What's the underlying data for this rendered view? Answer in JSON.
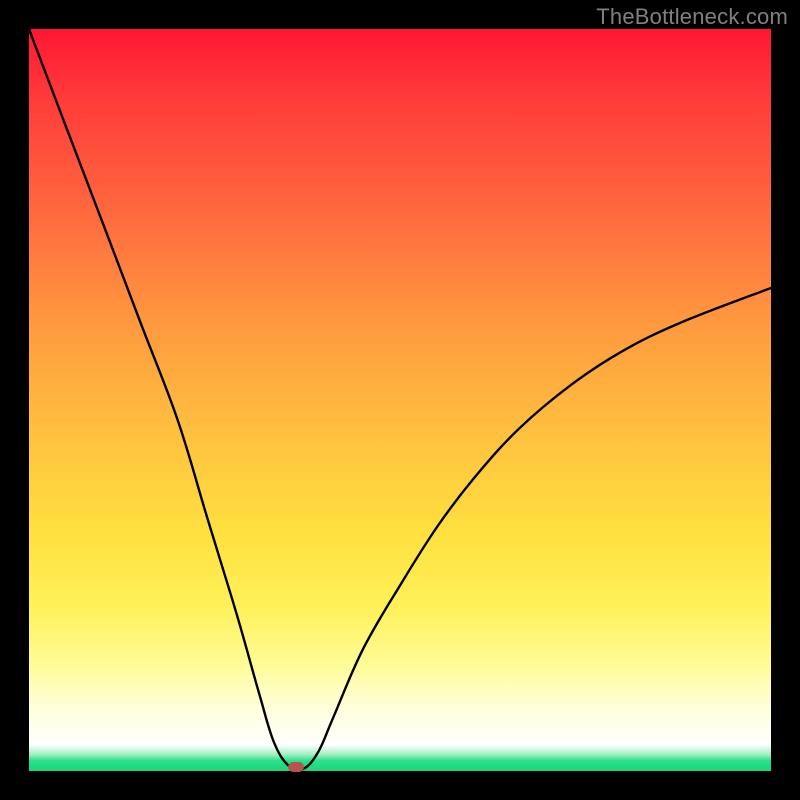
{
  "watermark": "TheBottleneck.com",
  "chart_data": {
    "type": "line",
    "title": "",
    "xlabel": "",
    "ylabel": "",
    "xlim": [
      0,
      100
    ],
    "ylim": [
      0,
      100
    ],
    "grid": false,
    "series": [
      {
        "name": "bottleneck-curve",
        "x": [
          0,
          5,
          10,
          15,
          20,
          24,
          28,
          31,
          33,
          35,
          37,
          39,
          41,
          45,
          50,
          55,
          60,
          66,
          73,
          80,
          88,
          100
        ],
        "values": [
          100,
          86.8,
          73.7,
          60.5,
          47.4,
          34.2,
          21.1,
          10.5,
          3.9,
          0.7,
          0.3,
          2.6,
          7.2,
          16.4,
          25.0,
          32.9,
          39.5,
          46.1,
          52.0,
          56.6,
          60.5,
          65.1
        ]
      }
    ],
    "marker": {
      "x": 36,
      "y": 0.5
    },
    "gradient_stops": [
      {
        "pct": 0,
        "color": "#ff1733"
      },
      {
        "pct": 40,
        "color": "#ff9a3f"
      },
      {
        "pct": 78,
        "color": "#fff15a"
      },
      {
        "pct": 96.5,
        "color": "#ffffff"
      },
      {
        "pct": 100,
        "color": "#19d67b"
      }
    ]
  }
}
